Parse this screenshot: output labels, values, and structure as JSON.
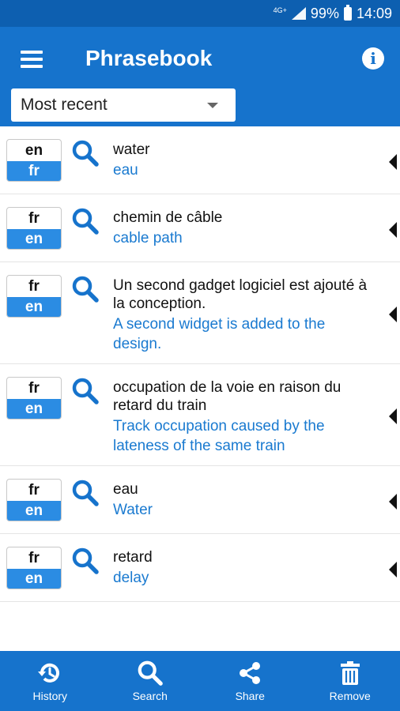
{
  "status_bar": {
    "network": "4G+",
    "battery": "99%",
    "time": "14:09"
  },
  "header": {
    "title": "Phrasebook"
  },
  "sort_select": {
    "value": "Most recent"
  },
  "phrases": [
    {
      "src_lang": "en",
      "dst_lang": "fr",
      "source": "water",
      "translation": "eau"
    },
    {
      "src_lang": "fr",
      "dst_lang": "en",
      "source": "chemin de câble",
      "translation": "cable path"
    },
    {
      "src_lang": "fr",
      "dst_lang": "en",
      "source": "Un second gadget logiciel est ajouté à la conception.",
      "translation": "A second widget is added to the design."
    },
    {
      "src_lang": "fr",
      "dst_lang": "en",
      "source": "occupation de la voie en raison du retard du train",
      "translation": "Track occupation caused by the lateness of the same train"
    },
    {
      "src_lang": "fr",
      "dst_lang": "en",
      "source": "eau",
      "translation": "Water"
    },
    {
      "src_lang": "fr",
      "dst_lang": "en",
      "source": "retard",
      "translation": "delay"
    }
  ],
  "bottom_nav": [
    {
      "label": "History",
      "icon": "history-icon"
    },
    {
      "label": "Search",
      "icon": "search-icon"
    },
    {
      "label": "Share",
      "icon": "share-icon"
    },
    {
      "label": "Remove",
      "icon": "trash-icon"
    }
  ],
  "colors": {
    "primary": "#1673cc",
    "status_bar": "#0d5fb0",
    "accent": "#2b8ce3",
    "translation_text": "#1a7ad0"
  }
}
